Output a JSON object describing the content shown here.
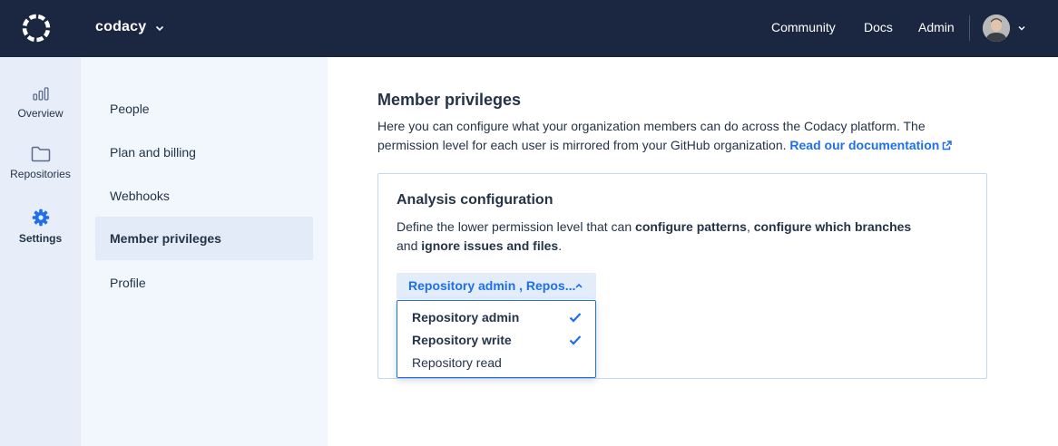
{
  "topbar": {
    "org_name": "codacy",
    "nav": [
      "Community",
      "Docs",
      "Admin"
    ]
  },
  "rail": {
    "items": [
      {
        "label": "Overview",
        "icon": "bar-chart-icon"
      },
      {
        "label": "Repositories",
        "icon": "folder-icon"
      },
      {
        "label": "Settings",
        "icon": "gear-icon",
        "active": true
      }
    ]
  },
  "subnav": {
    "items": [
      "People",
      "Plan and billing",
      "Webhooks",
      "Member privileges",
      "Profile"
    ],
    "active": "Member privileges"
  },
  "main": {
    "title": "Member privileges",
    "description": "Here you can configure what your organization members can do across the Codacy platform. The permission level for each user is mirrored from your GitHub organization.",
    "doc_link": "Read our documentation",
    "card": {
      "title": "Analysis configuration",
      "desc_1": "Define the lower permission level that can ",
      "desc_b1": "configure patterns",
      "desc_2": ", ",
      "desc_b2": "configure which branches",
      "desc_3": "and ",
      "desc_b3": "ignore issues and files",
      "desc_4": ".",
      "select_value": "Repository admin , Repos...",
      "options": [
        {
          "label": "Repository admin",
          "selected": true
        },
        {
          "label": "Repository write",
          "selected": true
        },
        {
          "label": "Repository read",
          "selected": false
        }
      ]
    }
  },
  "colors": {
    "topbar_bg": "#1b2641",
    "accent": "#1f6feb",
    "rail_bg": "#e8eef9",
    "subnav_bg": "#f2f6fd"
  }
}
